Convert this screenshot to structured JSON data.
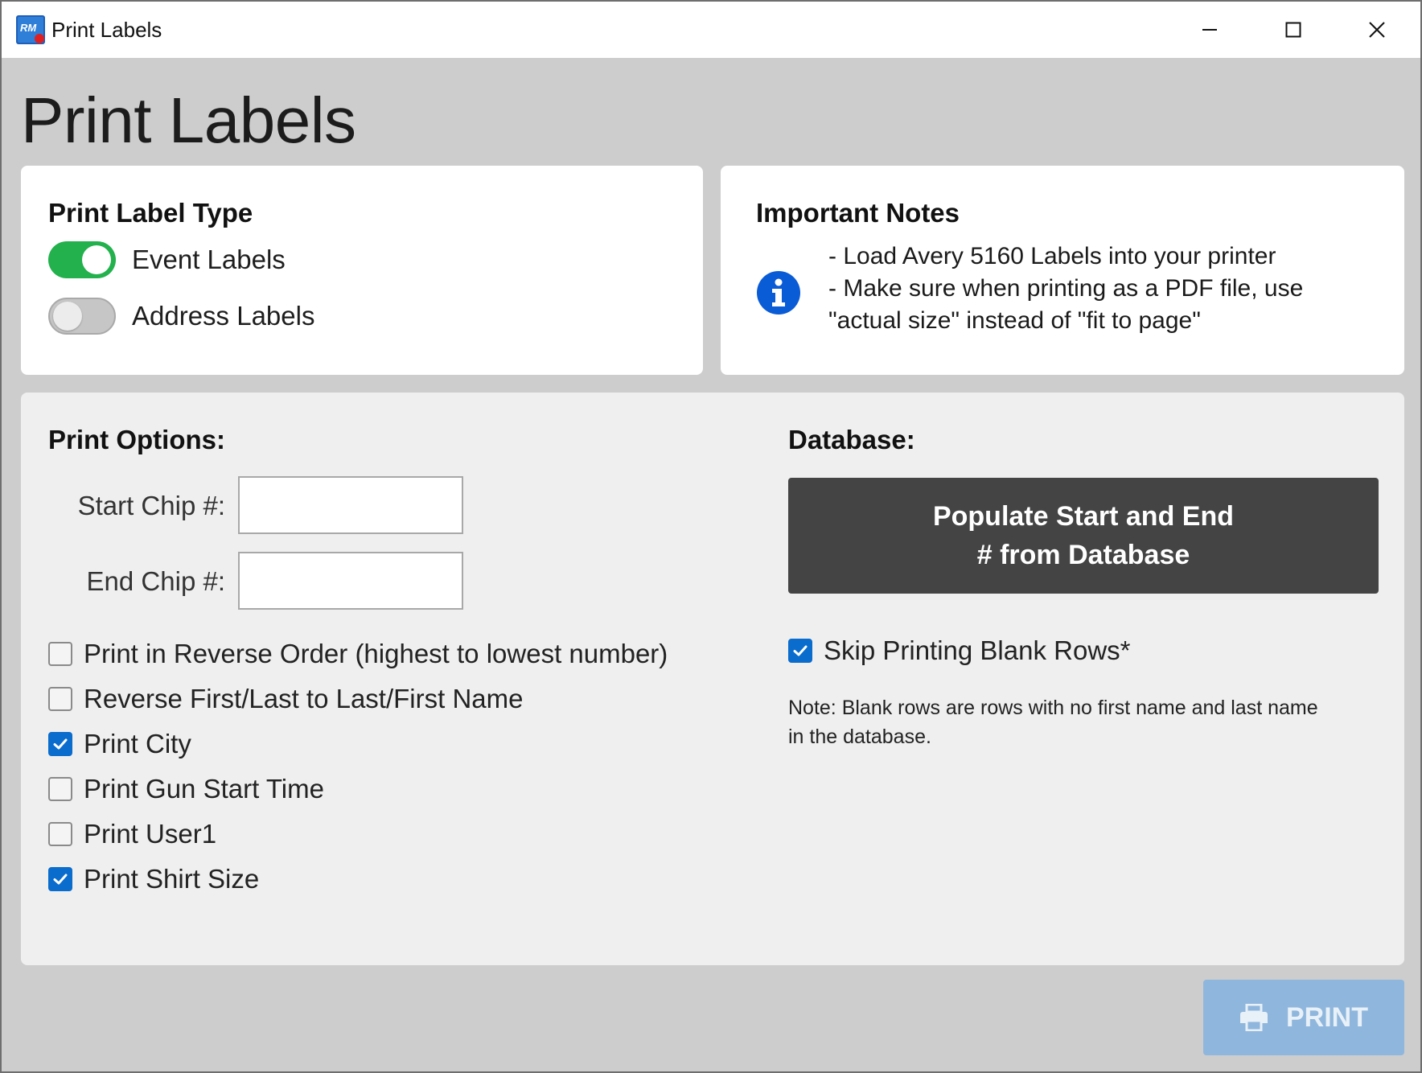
{
  "window": {
    "title": "Print Labels",
    "app_icon_text": "RM",
    "controls": [
      "minimize",
      "maximize",
      "close"
    ]
  },
  "page": {
    "title": "Print Labels"
  },
  "label_type": {
    "heading": "Print Label Type",
    "options": [
      {
        "label": "Event Labels",
        "on": true
      },
      {
        "label": "Address Labels",
        "on": false
      }
    ]
  },
  "notes": {
    "heading": "Important Notes",
    "icon": "info-icon",
    "lines": [
      "- Load Avery 5160 Labels into your printer",
      "- Make sure when printing as a PDF file, use",
      "\"actual size\" instead of \"fit to page\""
    ]
  },
  "print_options": {
    "heading": "Print Options:",
    "start_chip_label": "Start Chip #:",
    "start_chip_value": "",
    "end_chip_label": "End Chip #:",
    "end_chip_value": "",
    "checkboxes": [
      {
        "label": "Print in Reverse Order (highest to lowest number)",
        "checked": false
      },
      {
        "label": "Reverse First/Last to Last/First Name",
        "checked": false
      },
      {
        "label": "Print City",
        "checked": true
      },
      {
        "label": "Print Gun Start Time",
        "checked": false
      },
      {
        "label": "Print User1",
        "checked": false
      },
      {
        "label": "Print Shirt Size",
        "checked": true
      }
    ]
  },
  "database": {
    "heading": "Database:",
    "button_line1": "Populate Start and End",
    "button_line2": "# from Database",
    "skip_blank_label": "Skip Printing Blank Rows*",
    "skip_blank_checked": true,
    "note_line1": "Note: Blank rows are rows with no first name and last name",
    "note_line2": "in the database."
  },
  "actions": {
    "print_label": "PRINT",
    "print_icon": "printer-icon"
  },
  "colors": {
    "background": "#cdcdcd",
    "toggle_on": "#22b14c",
    "checkbox_on": "#0a6ccd",
    "info_icon": "#0a5bd6",
    "db_button": "#444444",
    "print_button": "#8fb6dc"
  }
}
